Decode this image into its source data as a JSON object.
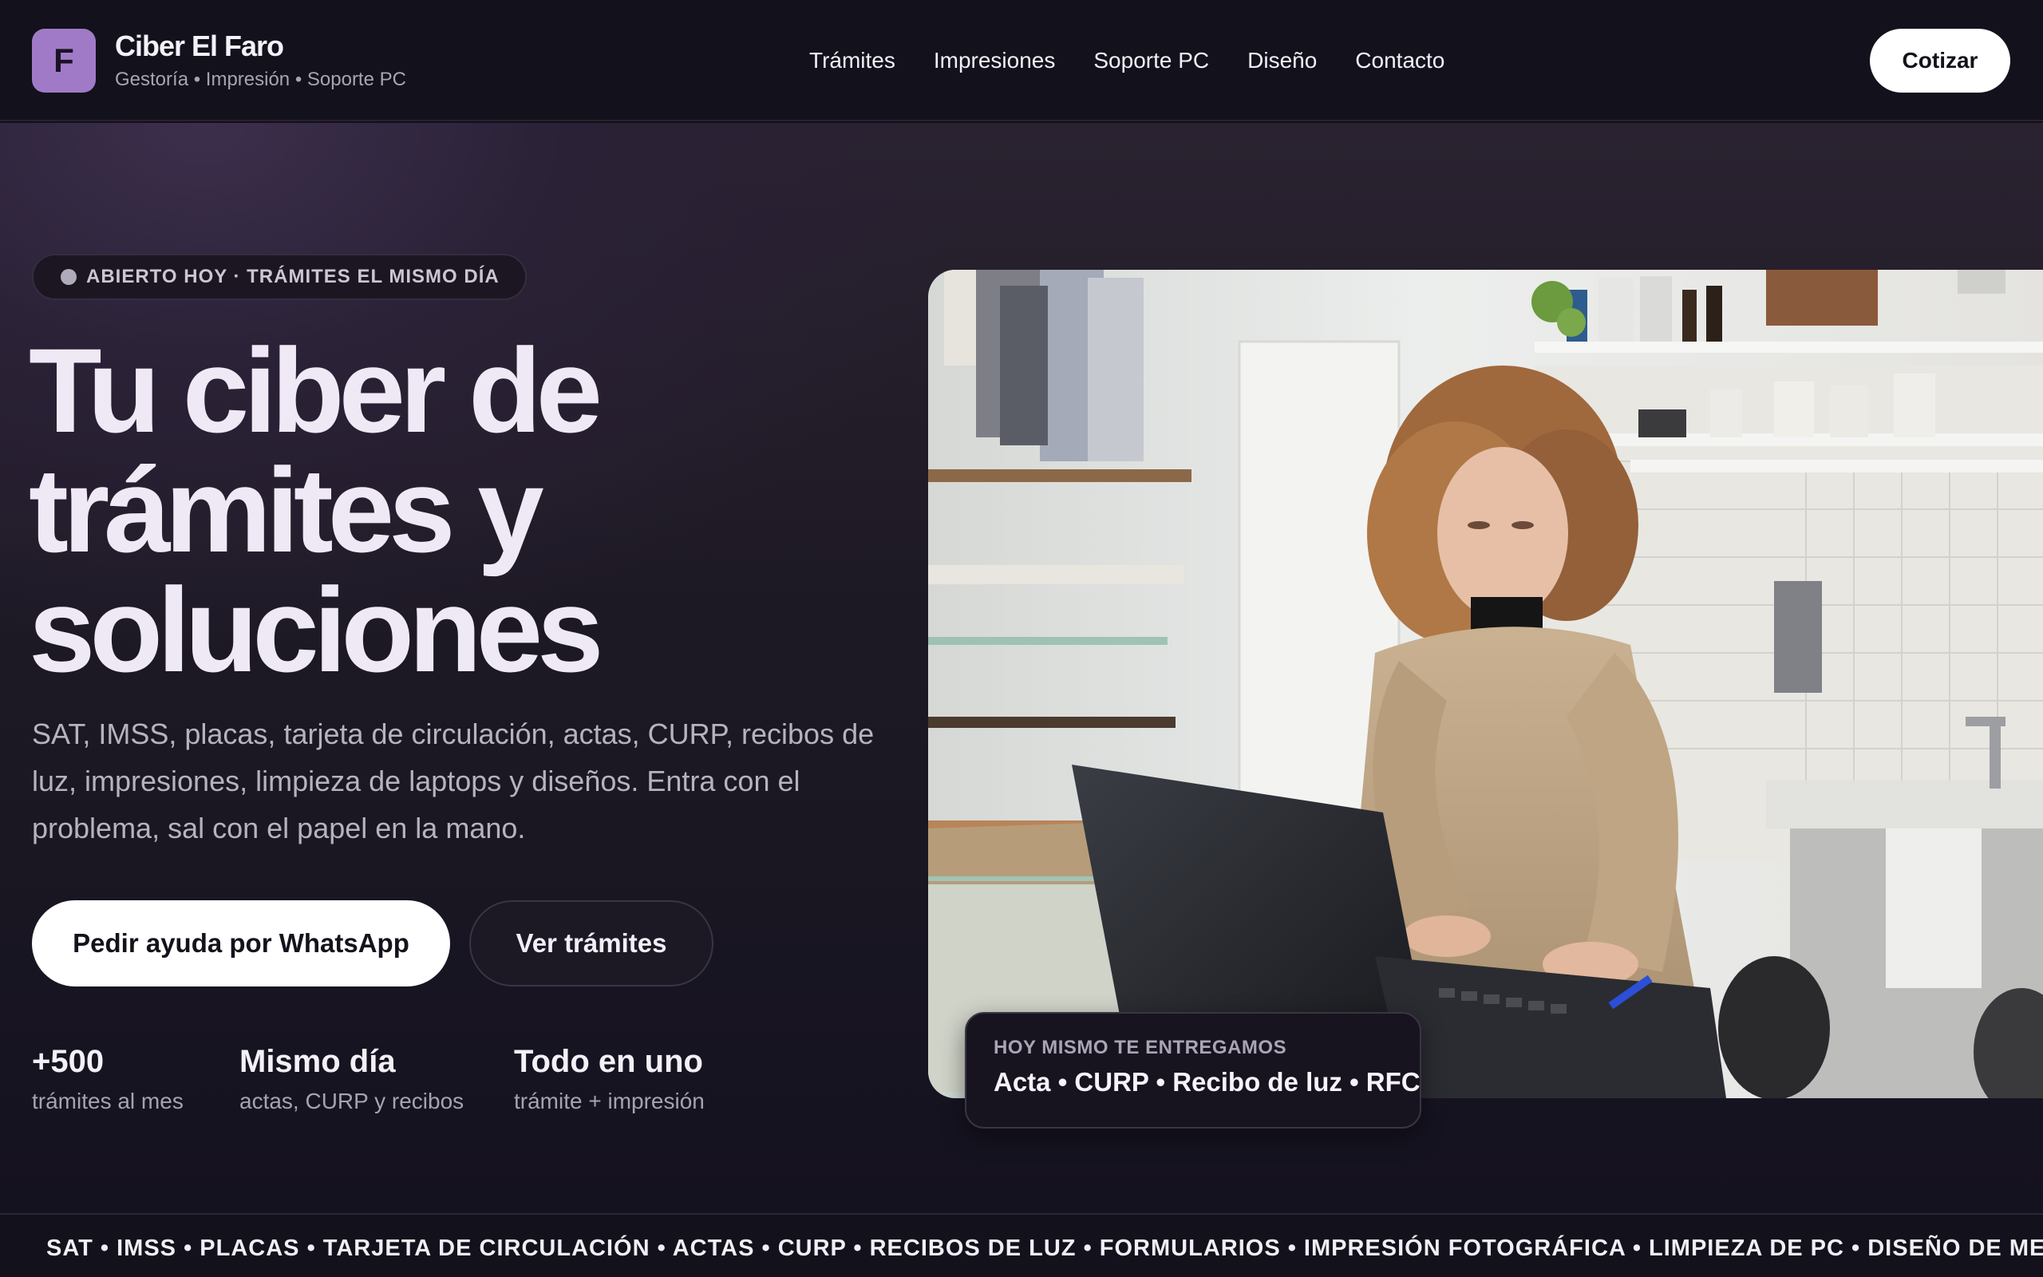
{
  "brand": {
    "logo_letter": "F",
    "name": "Ciber El Faro",
    "tagline": "Gestoría • Impresión • Soporte PC",
    "logo_color": "#a07ac7"
  },
  "nav": {
    "items": [
      {
        "label": "Trámites"
      },
      {
        "label": "Impresiones"
      },
      {
        "label": "Soporte PC"
      },
      {
        "label": "Diseño"
      },
      {
        "label": "Contacto"
      }
    ],
    "cta_label": "Cotizar"
  },
  "hero": {
    "badge": "ABIERTO HOY · TRÁMITES EL MISMO DÍA",
    "headline_lines": [
      "Tu ciber de",
      "trámites y",
      "soluciones"
    ],
    "lead": "SAT, IMSS, placas, tarjeta de circulación, actas, CURP, recibos de luz, impresiones, limpieza de laptops y diseños. Entra con el problema, sal con el papel en la mano.",
    "primary_button": "Pedir ayuda por WhatsApp",
    "secondary_button": "Ver trámites",
    "stats": [
      {
        "value": "+500",
        "label": "trámites al mes"
      },
      {
        "value": "Mismo día",
        "label": "actas, CURP y recibos"
      },
      {
        "value": "Todo en uno",
        "label": "trámite + impresión"
      }
    ]
  },
  "delivery_card": {
    "kicker": "HOY MISMO TE ENTREGAMOS",
    "items": "Acta • CURP • Recibo de luz • RFC"
  },
  "ticker": {
    "text": "SAT • IMSS • PLACAS • TARJETA DE CIRCULACIÓN • ACTAS • CURP • RECIBOS DE LUZ • FORMULARIOS • IMPRESIÓN FOTOGRÁFICA • LIMPIEZA DE PC • DISEÑO DE MENÚS Y"
  },
  "colors": {
    "background": "#120f1a",
    "header": "#13111c",
    "accent": "#a07ac7",
    "button_light": "#ffffff"
  }
}
